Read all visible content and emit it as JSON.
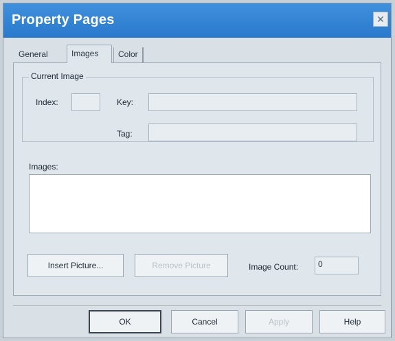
{
  "window": {
    "title": "Property Pages",
    "close_icon": "close-icon"
  },
  "tabs": [
    {
      "label": "General",
      "active": false
    },
    {
      "label": "Images",
      "active": true
    },
    {
      "label": "Color",
      "active": false
    }
  ],
  "current_image": {
    "group_label": "Current Image",
    "index_label": "Index:",
    "index_value": "",
    "key_label": "Key:",
    "key_value": "",
    "tag_label": "Tag:",
    "tag_value": ""
  },
  "images": {
    "label": "Images:"
  },
  "buttons": {
    "insert_picture": "Insert Picture...",
    "remove_picture": "Remove Picture",
    "image_count_label": "Image Count:",
    "image_count_value": "0"
  },
  "footer": {
    "ok": "OK",
    "cancel": "Cancel",
    "apply": "Apply",
    "help": "Help"
  }
}
